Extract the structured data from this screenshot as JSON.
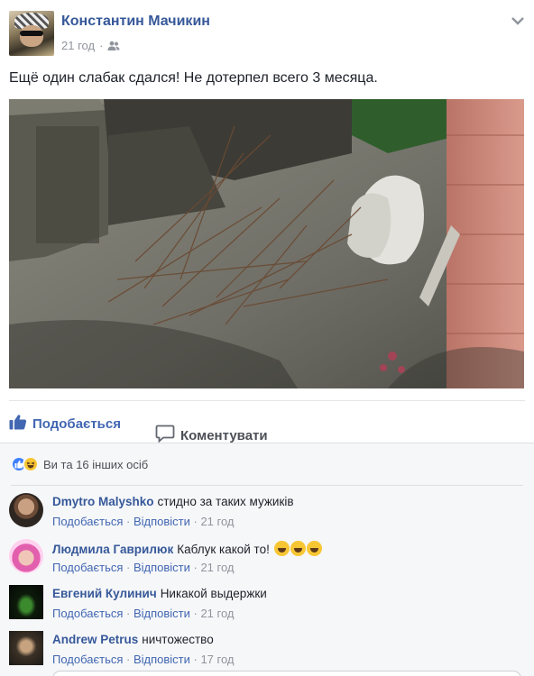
{
  "post": {
    "author": "Константин Мачикин",
    "time": "21 год",
    "separator": "·",
    "text": "Ещё один слабак сдался! Не дотерпел всего 3 месяца."
  },
  "actions": {
    "like_label": "Подобається",
    "comment_label": "Коментувати"
  },
  "reactions": {
    "summary": "Ви та 16 інших осіб"
  },
  "comments": [
    {
      "name": "Dmytro Malyshko",
      "text": "стидно за таких мужиків",
      "like": "Подобається",
      "reply": "Відповісти",
      "time": "21 год"
    },
    {
      "name": "Людмила Гаврилюк",
      "text": "Каблук какой то!",
      "like": "Подобається",
      "reply": "Відповісти",
      "time": "21 год"
    },
    {
      "name": "Евгений Кулинич",
      "text": "Никакой выдержки",
      "like": "Подобається",
      "reply": "Відповісти",
      "time": "21 год"
    },
    {
      "name": "Andrew Petrus",
      "text": "ничтожество",
      "like": "Подобається",
      "reply": "Відповісти",
      "time": "17 год"
    }
  ],
  "icons": {
    "like": "thumbs-up-icon",
    "comment": "speech-bubble-icon",
    "audience": "friends-icon",
    "more": "chevron-down-icon",
    "reaction_like": "like-reaction-icon",
    "reaction_haha": "haha-reaction-icon"
  },
  "colors": {
    "link": "#365899",
    "accent": "#4267b2",
    "muted": "#90949c",
    "background": "#f6f7f9"
  }
}
